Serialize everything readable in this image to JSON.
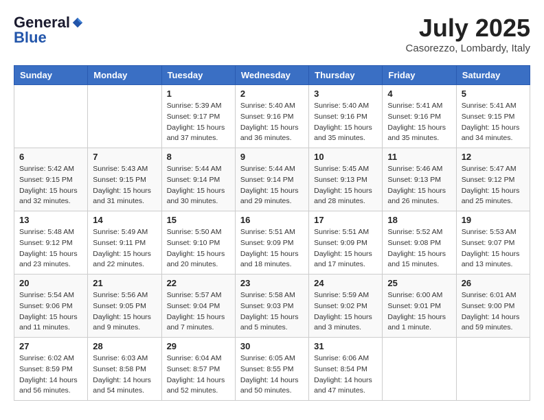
{
  "header": {
    "logo_general": "General",
    "logo_blue": "Blue",
    "month_title": "July 2025",
    "location": "Casorezzo, Lombardy, Italy"
  },
  "weekdays": [
    "Sunday",
    "Monday",
    "Tuesday",
    "Wednesday",
    "Thursday",
    "Friday",
    "Saturday"
  ],
  "weeks": [
    [
      {
        "day": "",
        "sunrise": "",
        "sunset": "",
        "daylight": ""
      },
      {
        "day": "",
        "sunrise": "",
        "sunset": "",
        "daylight": ""
      },
      {
        "day": "1",
        "sunrise": "Sunrise: 5:39 AM",
        "sunset": "Sunset: 9:17 PM",
        "daylight": "Daylight: 15 hours and 37 minutes."
      },
      {
        "day": "2",
        "sunrise": "Sunrise: 5:40 AM",
        "sunset": "Sunset: 9:16 PM",
        "daylight": "Daylight: 15 hours and 36 minutes."
      },
      {
        "day": "3",
        "sunrise": "Sunrise: 5:40 AM",
        "sunset": "Sunset: 9:16 PM",
        "daylight": "Daylight: 15 hours and 35 minutes."
      },
      {
        "day": "4",
        "sunrise": "Sunrise: 5:41 AM",
        "sunset": "Sunset: 9:16 PM",
        "daylight": "Daylight: 15 hours and 35 minutes."
      },
      {
        "day": "5",
        "sunrise": "Sunrise: 5:41 AM",
        "sunset": "Sunset: 9:15 PM",
        "daylight": "Daylight: 15 hours and 34 minutes."
      }
    ],
    [
      {
        "day": "6",
        "sunrise": "Sunrise: 5:42 AM",
        "sunset": "Sunset: 9:15 PM",
        "daylight": "Daylight: 15 hours and 32 minutes."
      },
      {
        "day": "7",
        "sunrise": "Sunrise: 5:43 AM",
        "sunset": "Sunset: 9:15 PM",
        "daylight": "Daylight: 15 hours and 31 minutes."
      },
      {
        "day": "8",
        "sunrise": "Sunrise: 5:44 AM",
        "sunset": "Sunset: 9:14 PM",
        "daylight": "Daylight: 15 hours and 30 minutes."
      },
      {
        "day": "9",
        "sunrise": "Sunrise: 5:44 AM",
        "sunset": "Sunset: 9:14 PM",
        "daylight": "Daylight: 15 hours and 29 minutes."
      },
      {
        "day": "10",
        "sunrise": "Sunrise: 5:45 AM",
        "sunset": "Sunset: 9:13 PM",
        "daylight": "Daylight: 15 hours and 28 minutes."
      },
      {
        "day": "11",
        "sunrise": "Sunrise: 5:46 AM",
        "sunset": "Sunset: 9:13 PM",
        "daylight": "Daylight: 15 hours and 26 minutes."
      },
      {
        "day": "12",
        "sunrise": "Sunrise: 5:47 AM",
        "sunset": "Sunset: 9:12 PM",
        "daylight": "Daylight: 15 hours and 25 minutes."
      }
    ],
    [
      {
        "day": "13",
        "sunrise": "Sunrise: 5:48 AM",
        "sunset": "Sunset: 9:12 PM",
        "daylight": "Daylight: 15 hours and 23 minutes."
      },
      {
        "day": "14",
        "sunrise": "Sunrise: 5:49 AM",
        "sunset": "Sunset: 9:11 PM",
        "daylight": "Daylight: 15 hours and 22 minutes."
      },
      {
        "day": "15",
        "sunrise": "Sunrise: 5:50 AM",
        "sunset": "Sunset: 9:10 PM",
        "daylight": "Daylight: 15 hours and 20 minutes."
      },
      {
        "day": "16",
        "sunrise": "Sunrise: 5:51 AM",
        "sunset": "Sunset: 9:09 PM",
        "daylight": "Daylight: 15 hours and 18 minutes."
      },
      {
        "day": "17",
        "sunrise": "Sunrise: 5:51 AM",
        "sunset": "Sunset: 9:09 PM",
        "daylight": "Daylight: 15 hours and 17 minutes."
      },
      {
        "day": "18",
        "sunrise": "Sunrise: 5:52 AM",
        "sunset": "Sunset: 9:08 PM",
        "daylight": "Daylight: 15 hours and 15 minutes."
      },
      {
        "day": "19",
        "sunrise": "Sunrise: 5:53 AM",
        "sunset": "Sunset: 9:07 PM",
        "daylight": "Daylight: 15 hours and 13 minutes."
      }
    ],
    [
      {
        "day": "20",
        "sunrise": "Sunrise: 5:54 AM",
        "sunset": "Sunset: 9:06 PM",
        "daylight": "Daylight: 15 hours and 11 minutes."
      },
      {
        "day": "21",
        "sunrise": "Sunrise: 5:56 AM",
        "sunset": "Sunset: 9:05 PM",
        "daylight": "Daylight: 15 hours and 9 minutes."
      },
      {
        "day": "22",
        "sunrise": "Sunrise: 5:57 AM",
        "sunset": "Sunset: 9:04 PM",
        "daylight": "Daylight: 15 hours and 7 minutes."
      },
      {
        "day": "23",
        "sunrise": "Sunrise: 5:58 AM",
        "sunset": "Sunset: 9:03 PM",
        "daylight": "Daylight: 15 hours and 5 minutes."
      },
      {
        "day": "24",
        "sunrise": "Sunrise: 5:59 AM",
        "sunset": "Sunset: 9:02 PM",
        "daylight": "Daylight: 15 hours and 3 minutes."
      },
      {
        "day": "25",
        "sunrise": "Sunrise: 6:00 AM",
        "sunset": "Sunset: 9:01 PM",
        "daylight": "Daylight: 15 hours and 1 minute."
      },
      {
        "day": "26",
        "sunrise": "Sunrise: 6:01 AM",
        "sunset": "Sunset: 9:00 PM",
        "daylight": "Daylight: 14 hours and 59 minutes."
      }
    ],
    [
      {
        "day": "27",
        "sunrise": "Sunrise: 6:02 AM",
        "sunset": "Sunset: 8:59 PM",
        "daylight": "Daylight: 14 hours and 56 minutes."
      },
      {
        "day": "28",
        "sunrise": "Sunrise: 6:03 AM",
        "sunset": "Sunset: 8:58 PM",
        "daylight": "Daylight: 14 hours and 54 minutes."
      },
      {
        "day": "29",
        "sunrise": "Sunrise: 6:04 AM",
        "sunset": "Sunset: 8:57 PM",
        "daylight": "Daylight: 14 hours and 52 minutes."
      },
      {
        "day": "30",
        "sunrise": "Sunrise: 6:05 AM",
        "sunset": "Sunset: 8:55 PM",
        "daylight": "Daylight: 14 hours and 50 minutes."
      },
      {
        "day": "31",
        "sunrise": "Sunrise: 6:06 AM",
        "sunset": "Sunset: 8:54 PM",
        "daylight": "Daylight: 14 hours and 47 minutes."
      },
      {
        "day": "",
        "sunrise": "",
        "sunset": "",
        "daylight": ""
      },
      {
        "day": "",
        "sunrise": "",
        "sunset": "",
        "daylight": ""
      }
    ]
  ]
}
